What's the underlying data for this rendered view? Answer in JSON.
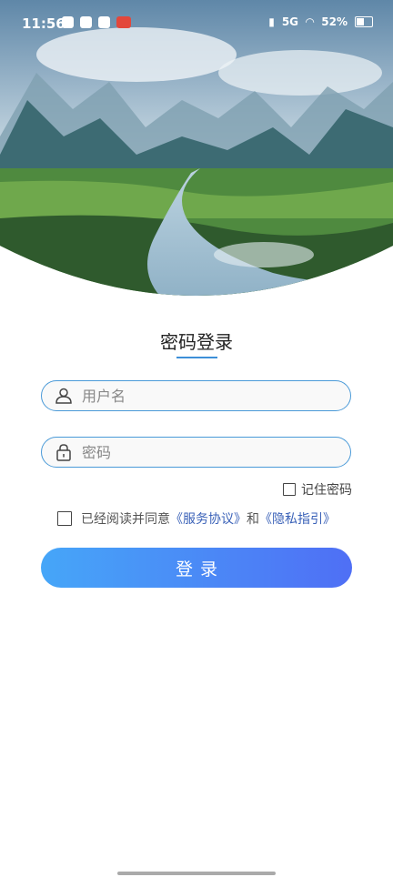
{
  "status": {
    "time": "11:56",
    "network": "5G",
    "battery": "52%"
  },
  "login": {
    "title": "密码登录",
    "username_placeholder": "用户名",
    "password_placeholder": "密码",
    "remember_label": "记住密码",
    "agree_prefix": "已经阅读并同意",
    "service_link": "《服务协议》",
    "and_text": "和",
    "privacy_link": "《隐私指引》",
    "submit_label": "登录"
  },
  "colors": {
    "accent": "#4a9ad8",
    "link": "#3b62b8",
    "button_start": "#46a6f8",
    "button_end": "#4f6ff5"
  },
  "icons": [
    "user-icon",
    "lock-icon",
    "battery-icon",
    "wifi-icon"
  ]
}
